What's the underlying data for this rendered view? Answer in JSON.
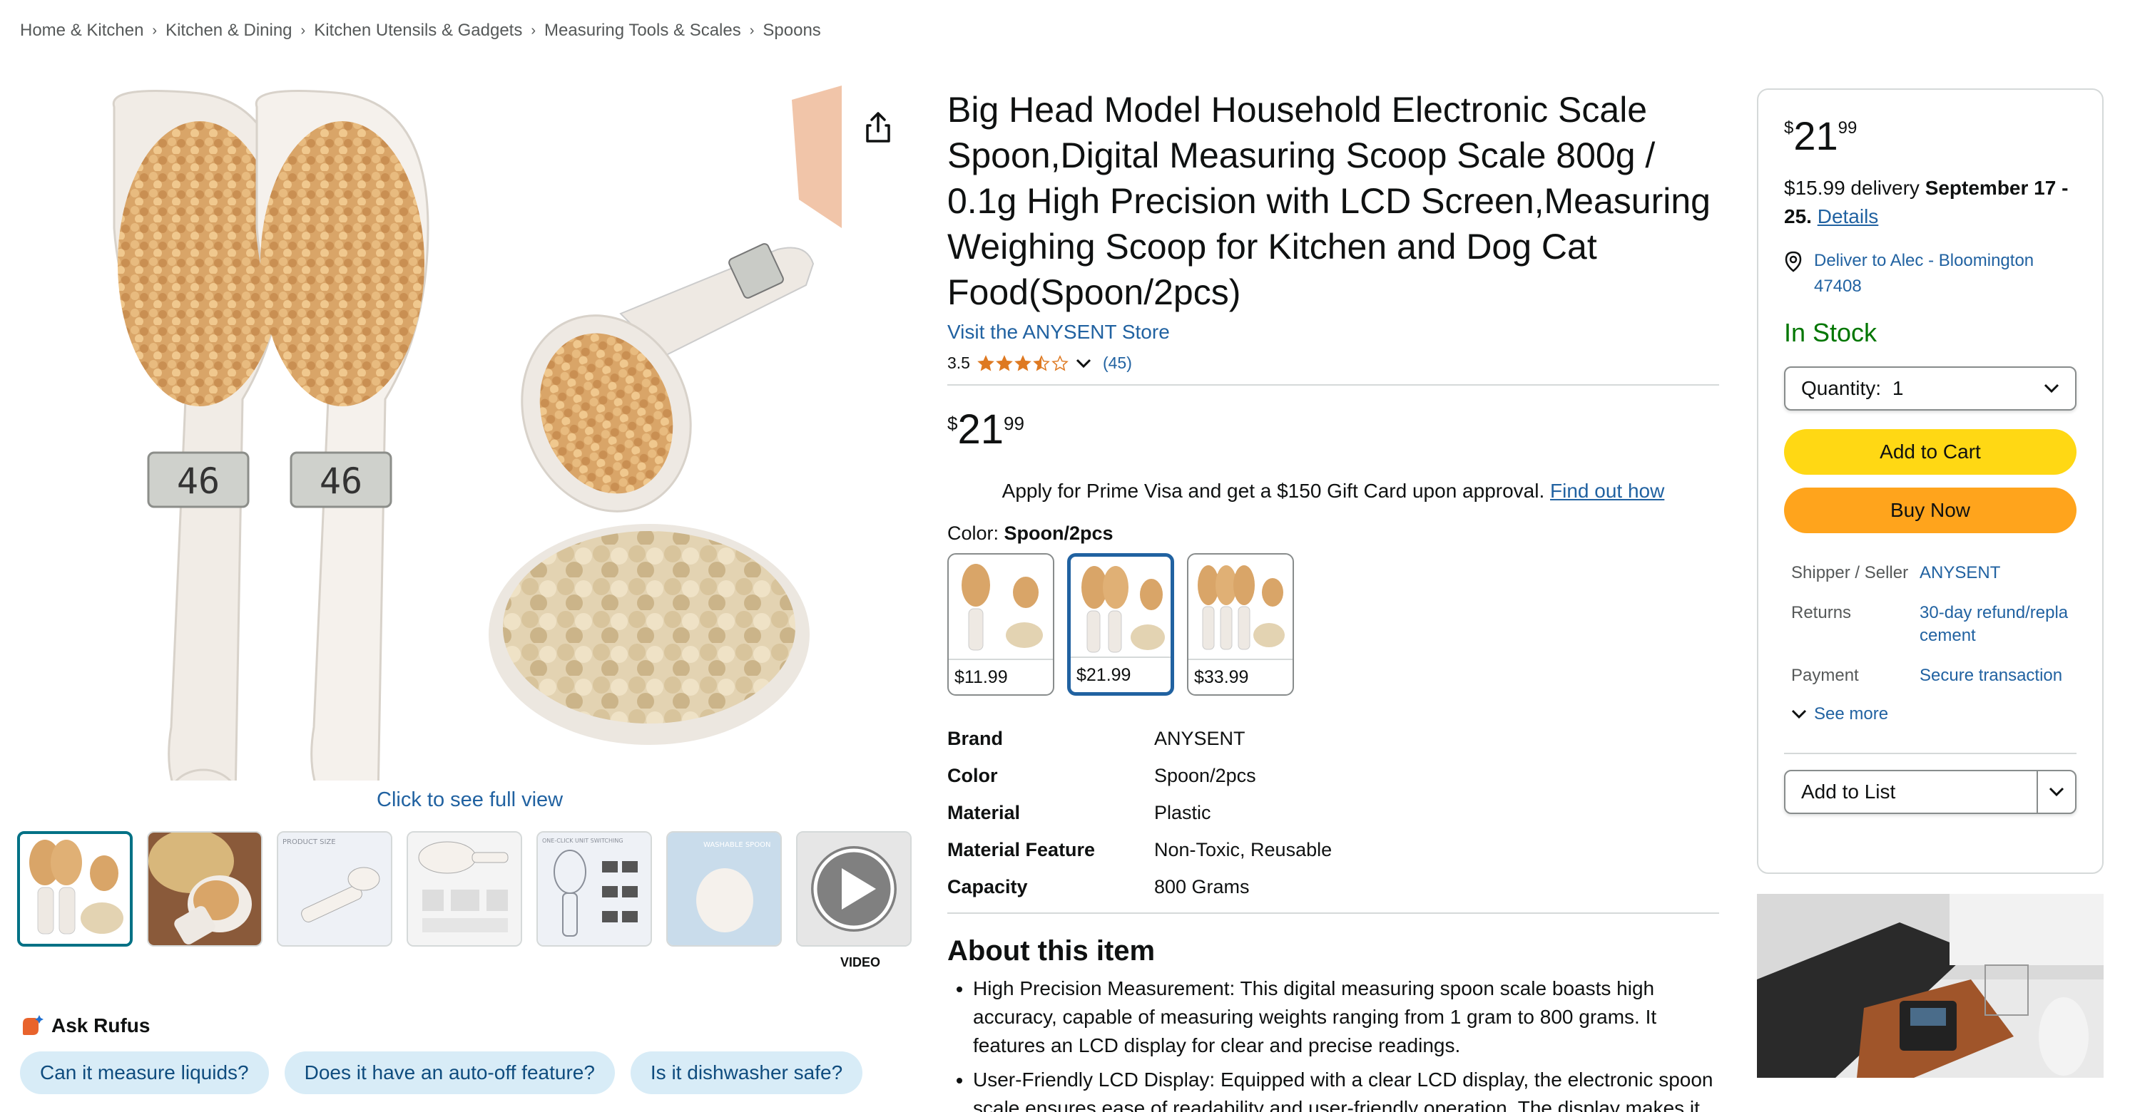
{
  "breadcrumb": [
    "Home & Kitchen",
    "Kitchen & Dining",
    "Kitchen Utensils & Gadgets",
    "Measuring Tools & Scales",
    "Spoons"
  ],
  "gallery": {
    "lcd_reading": "46",
    "full_view_label": "Click to see full view",
    "video_label": "VIDEO",
    "thumb_labels": [
      "",
      "",
      "PRODUCT SIZE",
      "",
      "ONE-CLICK UNIT SWITCHING",
      "WASHABLE SPOON",
      ""
    ]
  },
  "rufus": {
    "title": "Ask Rufus",
    "chips": [
      "Can it measure liquids?",
      "Does it have an auto-off feature?",
      "Is it dishwasher safe?"
    ]
  },
  "product": {
    "title": "Big Head Model Household Electronic Scale Spoon,Digital Measuring Scoop Scale 800g / 0.1g High Precision with LCD Screen,Measuring Weighing Scoop for Kitchen and Dog Cat Food(Spoon/2pcs)",
    "store_link": "Visit the ANYSENT Store",
    "rating": "3.5",
    "rating_value": 3.5,
    "rating_count": "(45)",
    "price": {
      "symbol": "$",
      "whole": "21",
      "fraction": "99"
    },
    "prime_visa_text": "Apply for Prime Visa and get a $150 Gift Card upon approval.",
    "prime_visa_link": "Find out how",
    "color_label": "Color:",
    "color_value": "Spoon/2pcs",
    "swatches": [
      {
        "price": "$11.99",
        "selected": false
      },
      {
        "price": "$21.99",
        "selected": true
      },
      {
        "price": "$33.99",
        "selected": false
      }
    ],
    "specs": [
      {
        "key": "Brand",
        "value": "ANYSENT"
      },
      {
        "key": "Color",
        "value": "Spoon/2pcs"
      },
      {
        "key": "Material",
        "value": "Plastic"
      },
      {
        "key": "Material Feature",
        "value": "Non-Toxic, Reusable"
      },
      {
        "key": "Capacity",
        "value": "800 Grams"
      }
    ],
    "about_title": "About this item",
    "bullets": [
      "High Precision Measurement: This digital measuring spoon scale boasts high accuracy, capable of measuring weights ranging from 1 gram to 800 grams. It features an LCD display for clear and precise readings.",
      "User-Friendly LCD Display: Equipped with a clear LCD display, the electronic spoon scale ensures ease of readability and user-friendly operation. The display makes it"
    ]
  },
  "buybox": {
    "price": {
      "symbol": "$",
      "whole": "21",
      "fraction": "99"
    },
    "delivery_prefix": "$15.99 delivery",
    "delivery_date": "September 17 - 25",
    "delivery_details": "Details",
    "deliver_to": "Deliver to Alec - Bloomington 47408",
    "stock": "In Stock",
    "quantity_label": "Quantity:",
    "quantity_value": "1",
    "add_to_cart": "Add to Cart",
    "buy_now": "Buy Now",
    "rows": [
      {
        "key": "Shipper / Seller",
        "value": "ANYSENT"
      },
      {
        "key": "Returns",
        "value": "30-day refund/replacement"
      },
      {
        "key": "Payment",
        "value": "Secure transaction"
      }
    ],
    "see_more": "See more",
    "add_to_list": "Add to List"
  },
  "colors": {
    "link": "#2162a1",
    "add_to_cart": "#ffd814",
    "buy_now": "#ffa41c",
    "in_stock": "#007600",
    "star": "#de7921",
    "chip_bg": "#d8ecf7"
  }
}
